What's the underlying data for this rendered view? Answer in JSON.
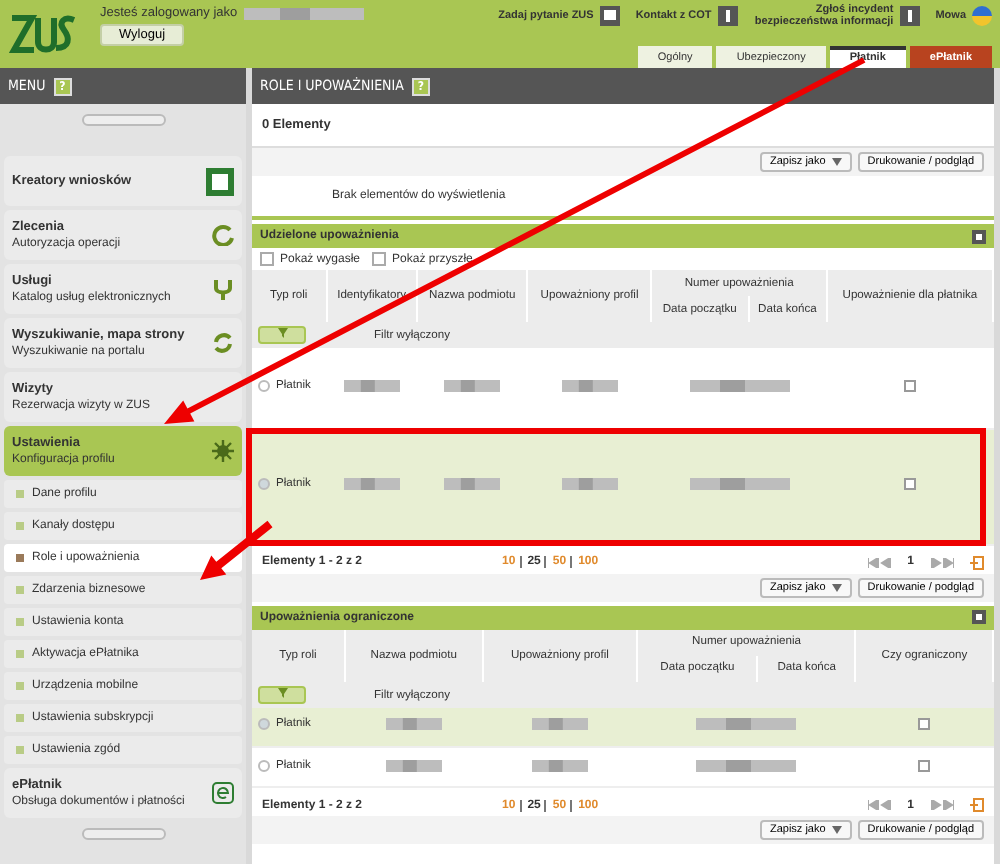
{
  "header": {
    "user_label": "Jesteś zalogowany jako",
    "logout": "Wyloguj",
    "links": [
      {
        "label": "Zadaj pytanie ZUS",
        "kind": "chat"
      },
      {
        "label": "Kontakt z COT",
        "kind": "info"
      },
      {
        "label": "Zgłoś incydent bezpieczeństwa informacji",
        "kind": "alert"
      }
    ],
    "language": "Mowa"
  },
  "tabs": [
    {
      "label": "Ogólny",
      "selected": false,
      "kind": "normal"
    },
    {
      "label": "Ubezpieczony",
      "selected": false,
      "kind": "normal"
    },
    {
      "label": "Płatnik",
      "selected": true,
      "kind": "normal"
    },
    {
      "label": "ePłatnik",
      "selected": false,
      "kind": "accent"
    }
  ],
  "menu": {
    "title": "MENU",
    "help": "?",
    "items": [
      {
        "title": "Kreatory wniosków",
        "selected": false
      },
      {
        "title": "Zlecenia",
        "subtitle": "Autoryzacja operacji",
        "selected": false
      },
      {
        "title": "Usługi",
        "subtitle": "Katalog usług elektronicznych",
        "selected": false
      },
      {
        "title": "Wyszukiwanie, mapa strony",
        "subtitle": "Wyszukiwanie na portalu",
        "selected": false
      },
      {
        "title": "Wizyty",
        "subtitle": "Rezerwacja wizyty w ZUS",
        "selected": false
      },
      {
        "title": "Ustawienia",
        "subtitle": "Konfiguracja profilu",
        "selected": true,
        "children": [
          {
            "label": "Dane profilu",
            "selected": false
          },
          {
            "label": "Kanały dostępu",
            "selected": false
          },
          {
            "label": "Role i upoważnienia",
            "selected": true
          },
          {
            "label": "Zdarzenia biznesowe",
            "selected": false
          },
          {
            "label": "Ustawienia konta",
            "selected": false
          },
          {
            "label": "Aktywacja ePłatnika",
            "selected": false
          },
          {
            "label": "Urządzenia mobilne",
            "selected": false
          },
          {
            "label": "Ustawienia subskrypcji",
            "selected": false
          },
          {
            "label": "Ustawienia zgód",
            "selected": false
          }
        ]
      },
      {
        "title": "ePłatnik",
        "subtitle": "Obsługa dokumentów i płatności",
        "selected": false
      }
    ]
  },
  "main": {
    "title": "ROLE I UPOWAŻNIENIA",
    "help": "?",
    "count": "0 Elementy",
    "save": "Zapisz jako",
    "print": "Drukowanie / podgląd",
    "empty": "Brak elementów do wyświetlenia"
  },
  "sections": [
    {
      "title": "Udzielone upoważnienia",
      "toggles": [
        {
          "label": "Pokaż wygasłe",
          "checked": false
        },
        {
          "label": "Pokaż przyszłe",
          "checked": false
        }
      ],
      "columns": [
        "Typ roli",
        "Identyfikatory",
        "Nazwa podmiotu",
        "Upoważniony profil"
      ],
      "group": "Numer upoważnienia",
      "subcolumns": [
        "Data początku",
        "Data końca"
      ],
      "last_column": "Upoważnienie dla płatnika",
      "filter": "Filtr wyłączony",
      "rows": [
        {
          "role": "Płatnik",
          "selected": false,
          "checked": false
        },
        {
          "role": "Płatnik",
          "selected": true,
          "checked": false
        }
      ],
      "footer": "Elementy 1 - 2 z 2",
      "page_sizes": [
        {
          "label": "10",
          "selected": false
        },
        {
          "label": "25",
          "selected": true
        },
        {
          "label": "50",
          "selected": false
        },
        {
          "label": "100",
          "selected": false
        }
      ],
      "page": "1",
      "save": "Zapisz jako",
      "print": "Drukowanie / podgląd"
    },
    {
      "title": "Upoważnienia ograniczone",
      "columns": [
        "Typ roli",
        "Nazwa podmiotu",
        "Upoważniony profil"
      ],
      "group": "Numer upoważnienia",
      "subcolumns": [
        "Data początku",
        "Data końca"
      ],
      "last_column": "Czy ograniczony",
      "filter": "Filtr wyłączony",
      "rows": [
        {
          "role": "Płatnik",
          "selected": true,
          "checked": false
        },
        {
          "role": "Płatnik",
          "selected": false,
          "checked": false
        }
      ],
      "footer": "Elementy 1 - 2 z 2",
      "page_sizes": [
        {
          "label": "10",
          "selected": false
        },
        {
          "label": "25",
          "selected": true
        },
        {
          "label": "50",
          "selected": false
        },
        {
          "label": "100",
          "selected": false
        }
      ],
      "page": "1",
      "save": "Zapisz jako",
      "print": "Drukowanie / podgląd"
    }
  ]
}
